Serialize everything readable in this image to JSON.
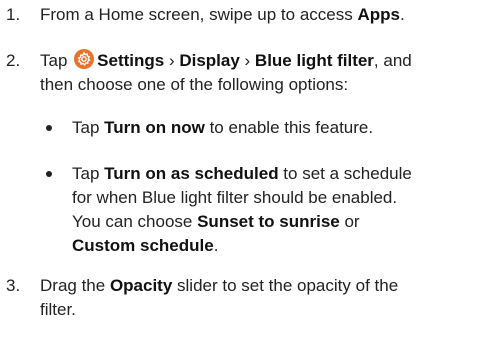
{
  "steps": [
    {
      "number": "1.",
      "pre": "From a Home screen, swipe up to access ",
      "bold": "Apps",
      "post": "."
    },
    {
      "number": "2.",
      "tap": "Tap",
      "settings": "Settings",
      "sep1": " › ",
      "display": "Display",
      "sep2": " › ",
      "filter": "Blue light filter",
      "post_line1": ", and",
      "line2": "then choose one of the following options:",
      "options": [
        {
          "pre": "Tap ",
          "bold": "Turn on now",
          "post": " to enable this feature."
        },
        {
          "pre": "Tap ",
          "bold": "Turn on as scheduled",
          "post": " to set a schedule",
          "line2": "for when Blue light filter should be enabled.",
          "line3_pre": "You can choose ",
          "line3_bold": "Sunset to sunrise",
          "line3_post": " or",
          "line4_bold": "Custom schedule",
          "line4_post": "."
        }
      ]
    },
    {
      "number": "3.",
      "pre": "Drag the ",
      "bold": "Opacity",
      "post": " slider to set the opacity of the",
      "line2": "filter."
    }
  ],
  "icons": {
    "settings": "settings-gear-icon"
  },
  "colors": {
    "icon_bg": "#e8742c",
    "text": "#222222"
  }
}
